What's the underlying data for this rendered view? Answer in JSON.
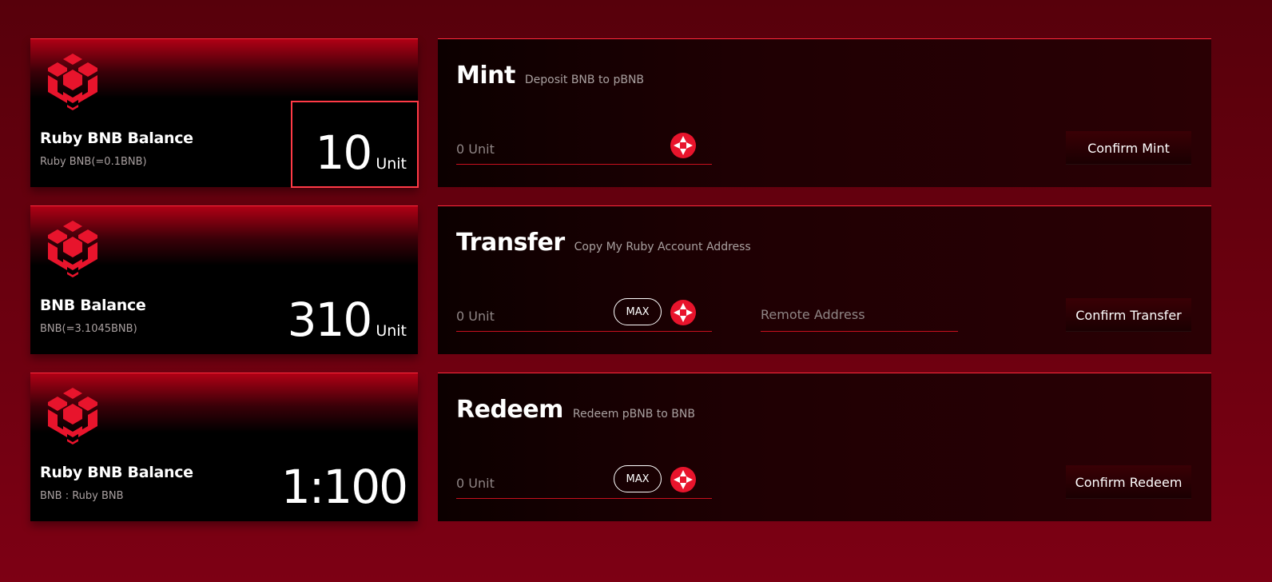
{
  "colors": {
    "accent": "#e8142c",
    "background_top": "#57000b",
    "background_bottom": "#7d0014",
    "card_bg": "#000000",
    "highlight": "#ff3a46"
  },
  "balances": [
    {
      "title": "Ruby BNB Balance",
      "subtitle": "Ruby BNB(=0.1BNB)",
      "value": "10",
      "unit": "Unit",
      "icon": "bnb-logo-icon"
    },
    {
      "title": "BNB Balance",
      "subtitle": "BNB(=3.1045BNB)",
      "value": "310",
      "unit": "Unit",
      "icon": "bnb-logo-icon"
    },
    {
      "title": "Ruby BNB Balance",
      "subtitle": "BNB : Ruby BNB",
      "value": "1:100",
      "unit": "",
      "icon": "bnb-logo-icon"
    }
  ],
  "mint": {
    "title": "Mint",
    "description": "Deposit BNB to pBNB",
    "amount_placeholder": "0 Unit",
    "amount_value": "",
    "confirm_label": "Confirm Mint"
  },
  "transfer": {
    "title": "Transfer",
    "description": "Copy My Ruby Account Address",
    "amount_placeholder": "0 Unit",
    "amount_value": "",
    "max_label": "MAX",
    "address_placeholder": "Remote Address",
    "address_value": "",
    "confirm_label": "Confirm Transfer"
  },
  "redeem": {
    "title": "Redeem",
    "description": "Redeem pBNB to BNB",
    "amount_placeholder": "0 Unit",
    "amount_value": "",
    "max_label": "MAX",
    "confirm_label": "Confirm Redeem"
  }
}
